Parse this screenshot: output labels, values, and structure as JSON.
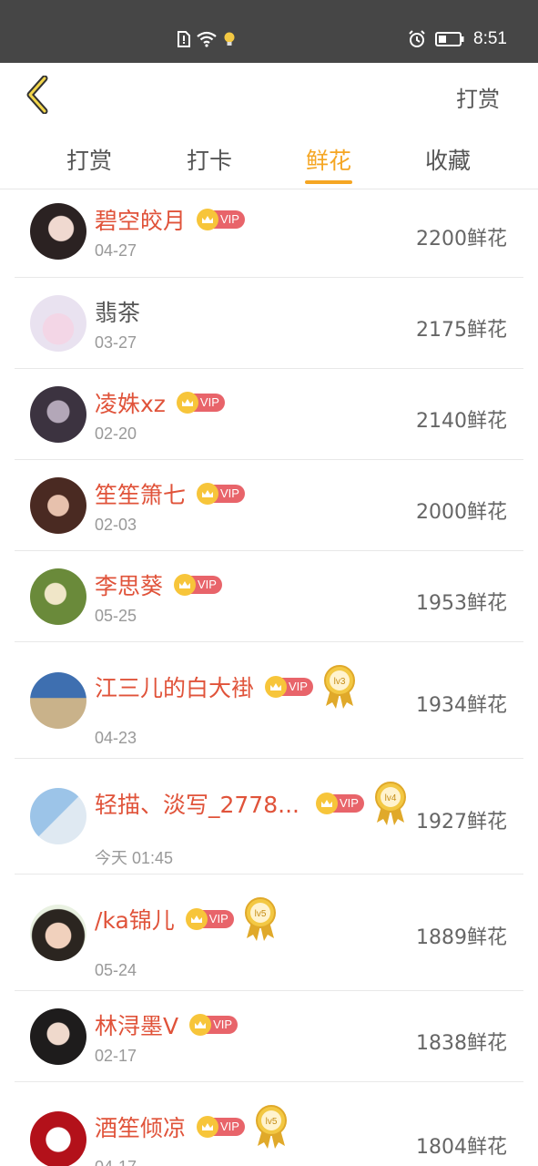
{
  "status_bar": {
    "time": "8:51"
  },
  "header": {
    "action_label": "打赏"
  },
  "tabs": [
    {
      "label": "打赏",
      "active": false
    },
    {
      "label": "打卡",
      "active": false
    },
    {
      "label": "鲜花",
      "active": true
    },
    {
      "label": "收藏",
      "active": false
    }
  ],
  "colors": {
    "accent": "#f5a623",
    "name_red": "#e0533a",
    "vip_badge": "#e8646a",
    "status_bar": "#464646"
  },
  "list": [
    {
      "name": "碧空皎月",
      "vip": true,
      "level": "",
      "date": "04-27",
      "amount": "2200鲜花"
    },
    {
      "name": "翡茶",
      "vip": false,
      "level": "",
      "date": "03-27",
      "amount": "2175鲜花"
    },
    {
      "name": "凌姝xz",
      "vip": true,
      "level": "",
      "date": "02-20",
      "amount": "2140鲜花"
    },
    {
      "name": "笙笙箫七",
      "vip": true,
      "level": "",
      "date": "02-03",
      "amount": "2000鲜花"
    },
    {
      "name": "李思葵",
      "vip": true,
      "level": "",
      "date": "05-25",
      "amount": "1953鲜花"
    },
    {
      "name": "江三儿的白大褂",
      "vip": true,
      "level": "lv3",
      "date": "04-23",
      "amount": "1934鲜花"
    },
    {
      "name": "轻描、淡写_2778...",
      "vip": true,
      "level": "lv4",
      "date": "今天 01:45",
      "amount": "1927鲜花"
    },
    {
      "name": "/ka锦儿",
      "vip": true,
      "level": "lv5",
      "date": "05-24",
      "amount": "1889鲜花"
    },
    {
      "name": "林浔墨V",
      "vip": true,
      "level": "",
      "date": "02-17",
      "amount": "1838鲜花"
    },
    {
      "name": "酒笙倾凉",
      "vip": true,
      "level": "lv5",
      "date": "04-17",
      "amount": "1804鲜花"
    }
  ],
  "vip_label": "VIP"
}
